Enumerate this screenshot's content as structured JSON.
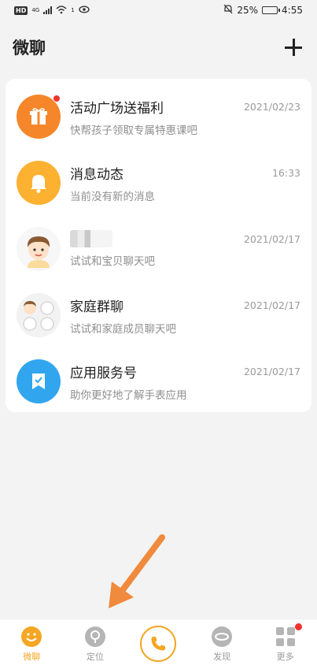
{
  "status_bar": {
    "hd": "HD",
    "network": "4G",
    "extra": "1",
    "battery": "25%",
    "time": "4:55",
    "battery_level": 0.25
  },
  "header": {
    "title": "微聊",
    "add_icon": "plus-icon"
  },
  "chats": [
    {
      "name": "活动广场送福利",
      "time": "2021/02/23",
      "preview": "快帮孩子领取专属特惠课吧",
      "icon": "gift-icon",
      "unread": true
    },
    {
      "name": "消息动态",
      "time": "16:33",
      "preview": "当前没有新的消息",
      "icon": "bell-icon",
      "unread": false
    },
    {
      "name": "",
      "time": "2021/02/17",
      "preview": "试试和宝贝聊天吧",
      "icon": "child-avatar",
      "unread": false
    },
    {
      "name": "家庭群聊",
      "time": "2021/02/17",
      "preview": "试试和家庭成员聊天吧",
      "icon": "group-avatar",
      "unread": false
    },
    {
      "name": "应用服务号",
      "time": "2021/02/17",
      "preview": "助你更好地了解手表应用",
      "icon": "service-icon",
      "unread": false
    }
  ],
  "nav": {
    "items": [
      {
        "label": "微聊",
        "icon": "chat-icon",
        "active": true
      },
      {
        "label": "定位",
        "icon": "location-icon",
        "active": false
      },
      {
        "label": "",
        "icon": "phone-icon",
        "active": false
      },
      {
        "label": "发现",
        "icon": "discover-icon",
        "active": false
      },
      {
        "label": "更多",
        "icon": "more-icon",
        "active": false
      }
    ]
  },
  "colors": {
    "accent": "#f5a623",
    "orange": "#f5872a",
    "yellow": "#fdb131",
    "blue": "#31a6ef",
    "badge": "#f0342e",
    "annotation": "#f08a3c"
  }
}
